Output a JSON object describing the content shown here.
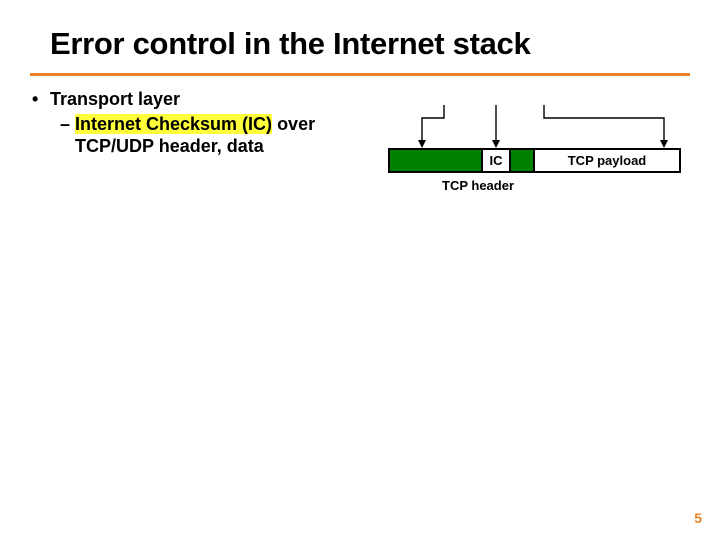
{
  "title": "Error control in the Internet stack",
  "bullets": {
    "lvl1": "Transport layer",
    "lvl2_highlight": "Internet Checksum (IC)",
    "lvl2_rest_a": " over",
    "lvl2_rest_b": "TCP/UDP header, data"
  },
  "diagram": {
    "ic_label": "IC",
    "payload_label": "TCP payload",
    "header_label": "TCP header"
  },
  "page_number": "5"
}
